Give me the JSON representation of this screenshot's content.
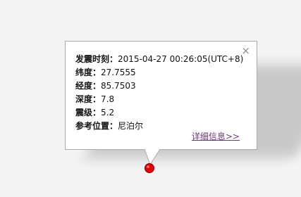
{
  "popup": {
    "close_symbol": "×",
    "rows": [
      {
        "label": "发震时刻：",
        "value": "2015-04-27 00:26:05(UTC+8)"
      },
      {
        "label": "纬度：",
        "value": "27.7555"
      },
      {
        "label": "经度：",
        "value": "85.7503"
      },
      {
        "label": "深度：",
        "value": "7.8"
      },
      {
        "label": "震级：",
        "value": "5.2"
      },
      {
        "label": "参考位置：",
        "value": "尼泊尔"
      }
    ],
    "detail_link": "详细信息>>"
  },
  "icons": {
    "close": "close-icon",
    "marker": "epicenter-marker-icon"
  },
  "colors": {
    "marker_fill": "#e60000",
    "link": "#6e3580",
    "border": "#a9a9a9"
  }
}
